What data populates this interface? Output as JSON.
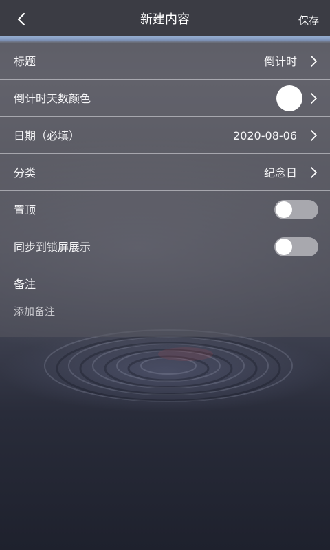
{
  "header": {
    "title": "新建内容",
    "save_label": "保存",
    "back_icon": "chevron-left-icon"
  },
  "rows": [
    {
      "label": "标题",
      "value": "倒计时",
      "control": "chevron"
    },
    {
      "label": "倒计时天数颜色",
      "control": "color-swatch",
      "color": "#ffffff"
    },
    {
      "label": "日期（必填）",
      "value": "2020-08-06",
      "control": "chevron"
    },
    {
      "label": "分类",
      "value": "纪念日",
      "control": "chevron"
    },
    {
      "label": "置顶",
      "control": "toggle",
      "on": false
    },
    {
      "label": "同步到锁屏展示",
      "control": "toggle",
      "on": false
    }
  ],
  "note": {
    "label": "备注",
    "placeholder": "添加备注",
    "value": ""
  },
  "colors": {
    "header_bg": "#3b3c44",
    "accent_line": "#8fa7cc",
    "toggle_off": "#a8a8ae"
  }
}
